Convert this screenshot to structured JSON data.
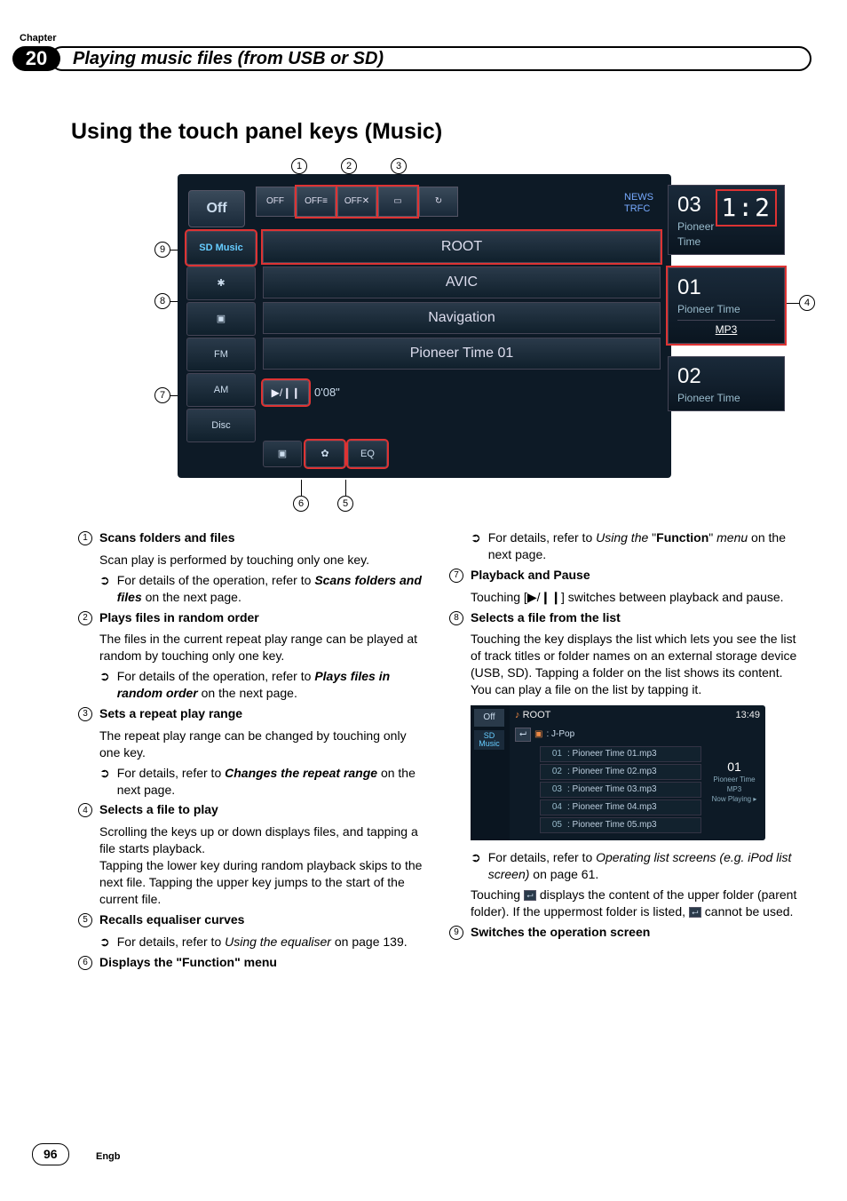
{
  "chapter": {
    "label": "Chapter",
    "number": "20",
    "title": "Playing music files (from USB or SD)"
  },
  "section": {
    "prefix": "Using the touch panel keys (",
    "mode": "Music",
    "suffix": ")"
  },
  "callouts": {
    "1": "1",
    "2": "2",
    "3": "3",
    "4": "4",
    "5": "5",
    "6": "6",
    "7": "7",
    "8": "8",
    "9": "9"
  },
  "mainshot": {
    "off": "Off",
    "top_btns": {
      "a": "OFF",
      "b": "OFF≡",
      "c": "OFF✕",
      "d": "▭",
      "e": "↻"
    },
    "news": "NEWS",
    "trfc": "TRFC",
    "side": {
      "sdmusic": "SD\nMusic",
      "bt": "✱",
      "vid": "▣",
      "fm": "FM",
      "am": "AM",
      "disc": "Disc"
    },
    "center": {
      "root": "ROOT",
      "avic": "AVIC",
      "nav": "Navigation",
      "track": "Pioneer Time 01"
    },
    "play": {
      "btn": "▶/❙❙",
      "time": "0'08\""
    },
    "bottom": {
      "home": "▣",
      "gear": "✿",
      "eq": "EQ"
    },
    "right": {
      "top_num": "03",
      "top_time": "1:2",
      "top_sub": "Pioneer Time",
      "mid_num": "01",
      "mid_sub": "Pioneer Time",
      "mp3": "MP3",
      "bot_num": "02",
      "bot_sub": "Pioneer Time"
    }
  },
  "smallshot": {
    "off": "Off",
    "sd": "SD\nMusic",
    "root": "ROOT",
    "time": "13:49",
    "folder_icon": "▣",
    "folder": ": J-Pop",
    "up": "⮠",
    "rows": [
      {
        "n": "01",
        "t": ": Pioneer Time 01.mp3"
      },
      {
        "n": "02",
        "t": ": Pioneer Time 02.mp3"
      },
      {
        "n": "03",
        "t": ": Pioneer Time 03.mp3"
      },
      {
        "n": "04",
        "t": ": Pioneer Time 04.mp3"
      },
      {
        "n": "05",
        "t": ": Pioneer Time 05.mp3"
      }
    ],
    "np_num": "01",
    "np_sub": "Pioneer Time",
    "np_badge": "MP3",
    "np_label": "Now Playing ▸"
  },
  "left_items": {
    "i1": {
      "title": "Scans folders and files",
      "body": "Scan play is performed by touching only one key.",
      "sub_pre": "For details of the operation, refer to ",
      "sub_bi": "Scans folders and files",
      "sub_post": " on the next page."
    },
    "i2": {
      "title": "Plays files in random order",
      "body": "The files in the current repeat play range can be played at random by touching only one key.",
      "sub_pre": "For details of the operation, refer to ",
      "sub_bi": "Plays files in random order",
      "sub_post": " on the next page."
    },
    "i3": {
      "title": "Sets a repeat play range",
      "body": "The repeat play range can be changed by touching only one key.",
      "sub_pre": "For details, refer to ",
      "sub_bi": "Changes the repeat range",
      "sub_post": " on the next page."
    },
    "i4": {
      "title": "Selects a file to play",
      "body": "Scrolling the keys up or down displays files, and tapping a file starts playback.\nTapping the lower key during random playback skips to the next file. Tapping the upper key jumps to the start of the current file."
    },
    "i5": {
      "title": "Recalls equaliser curves",
      "sub_pre": "For details, refer to ",
      "sub_i": "Using the equaliser",
      "sub_post": " on page 139."
    },
    "i6": {
      "title": "Displays the \"Function\" menu"
    }
  },
  "right_items": {
    "top_sub_pre": "For details, refer to ",
    "top_sub_i": "Using the ",
    "top_sub_q": "\"",
    "top_sub_b": "Function",
    "top_sub_q2": "\"",
    "top_sub_i2": " menu",
    "top_sub_post": " on the next page.",
    "i7": {
      "title": "Playback and Pause",
      "body_pre": "Touching [",
      "body_sym": "▶/❙❙",
      "body_post": "] switches between playback and pause."
    },
    "i8": {
      "title": "Selects a file from the list",
      "body": "Touching the key displays the list which lets you see the list of track titles or folder names on an external storage device (USB, SD). Tapping a folder on the list shows its content. You can play a file on the list by tapping it.",
      "sub_pre": "For details, refer to ",
      "sub_i": "Operating list screens (e.g. iPod list screen)",
      "sub_post": " on page 61.",
      "tail_pre": "Touching ",
      "tail_mid": " displays the content of the upper folder (parent folder). If the uppermost folder is listed, ",
      "tail_post": " cannot be used."
    },
    "i9": {
      "title": "Switches the operation screen"
    }
  },
  "footer": {
    "page": "96",
    "engb": "Engb"
  },
  "arrows": {
    "detail": "➲"
  },
  "inline_up": "⮠"
}
